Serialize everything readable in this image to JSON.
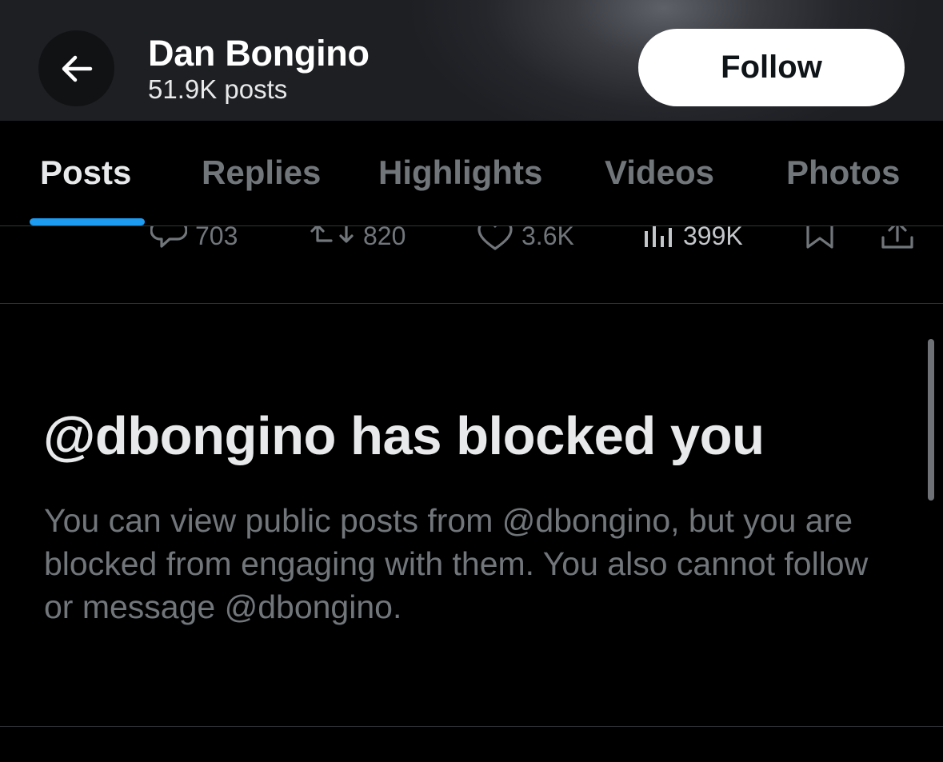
{
  "header": {
    "name": "Dan Bongino",
    "post_count": "51.9K posts",
    "follow_label": "Follow",
    "back_icon": "arrow-left-icon"
  },
  "tabs": [
    {
      "label": "Posts",
      "active": true
    },
    {
      "label": "Replies",
      "active": false
    },
    {
      "label": "Highlights",
      "active": false
    },
    {
      "label": "Videos",
      "active": false
    },
    {
      "label": "Photos",
      "active": false
    }
  ],
  "tweet_actions": {
    "replies": "703",
    "reposts": "820",
    "likes": "3.6K",
    "views": "399K"
  },
  "blocked": {
    "title": "@dbongino has blocked you",
    "description": "You can view public posts from @dbongino, but you are blocked from engaging with them. You also cannot follow or message @dbongino."
  },
  "colors": {
    "accent": "#1d9bf0",
    "background": "#000000",
    "text_primary": "#e7e9ea",
    "text_secondary": "#71767b"
  }
}
